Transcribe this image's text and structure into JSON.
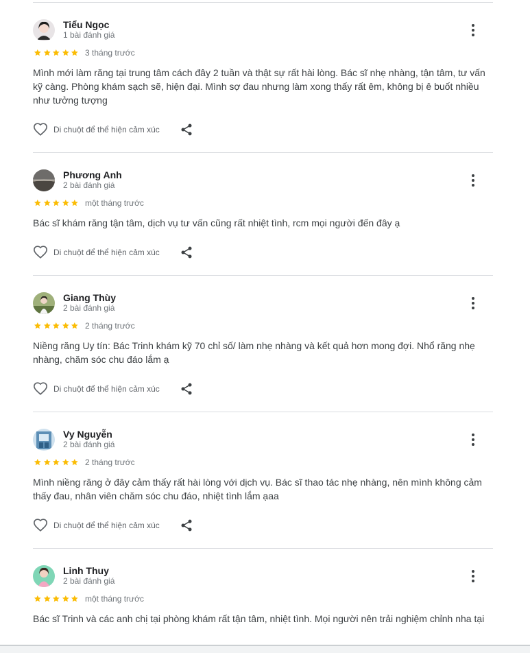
{
  "reviews": [
    {
      "name": "Tiểu Ngọc",
      "review_count": "1 bài đánh giá",
      "rating": 5,
      "time": "3 tháng trước",
      "text": "Mình mới làm răng tại trung tâm cách đây 2 tuần và thật sự rất hài lòng. Bác sĩ nhẹ nhàng, tận tâm, tư vấn kỹ càng. Phòng khám sạch sẽ, hiện đại. Mình sợ đau nhưng làm xong thấy rất êm, không bị ê buốt nhiều như tưởng tượng",
      "reaction_label": "Di chuột để thể hiện cảm xúc"
    },
    {
      "name": "Phương Anh",
      "review_count": "2 bài đánh giá",
      "rating": 5,
      "time": "một tháng trước",
      "text": "Bác sĩ khám răng tận tâm, dịch vụ tư vấn cũng rất nhiệt tình, rcm mọi người đến đây ạ",
      "reaction_label": "Di chuột để thể hiện cảm xúc"
    },
    {
      "name": "Giang Thùy",
      "review_count": "2 bài đánh giá",
      "rating": 5,
      "time": "2 tháng trước",
      "text": "Niềng răng Uy tín: Bác Trinh khám kỹ 70 chỉ số/ làm nhẹ nhàng và kết quả hơn mong đợi. Nhổ răng nhẹ nhàng, chăm sóc chu đáo lắm ạ",
      "reaction_label": "Di chuột để thể hiện cảm xúc"
    },
    {
      "name": "Vy Nguyễn",
      "review_count": "2 bài đánh giá",
      "rating": 5,
      "time": "2 tháng trước",
      "text": "Mình niềng răng ở đây cảm thấy rất hài lòng với dịch vụ. Bác sĩ thao tác nhẹ nhàng, nên mình không cảm thấy đau, nhân viên chăm sóc chu đáo, nhiệt tình lắm ạaa",
      "reaction_label": "Di chuột để thể hiện cảm xúc"
    },
    {
      "name": "Linh Thuy",
      "review_count": "2 bài đánh giá",
      "rating": 5,
      "time": "một tháng trước",
      "text": "Bác sĩ Trinh và các anh chị tại phòng khám rất tận tâm, nhiệt tình. Mọi người nên trải nghiệm chỉnh nha tại",
      "reaction_label": ""
    }
  ],
  "colors": {
    "star": "#fbbc04",
    "divider": "#dadce0",
    "name": "#202124",
    "meta": "#70757a",
    "body": "#3c4043"
  },
  "icons": [
    "more-vert-icon",
    "star-icon",
    "heart-outline-icon",
    "share-icon"
  ]
}
